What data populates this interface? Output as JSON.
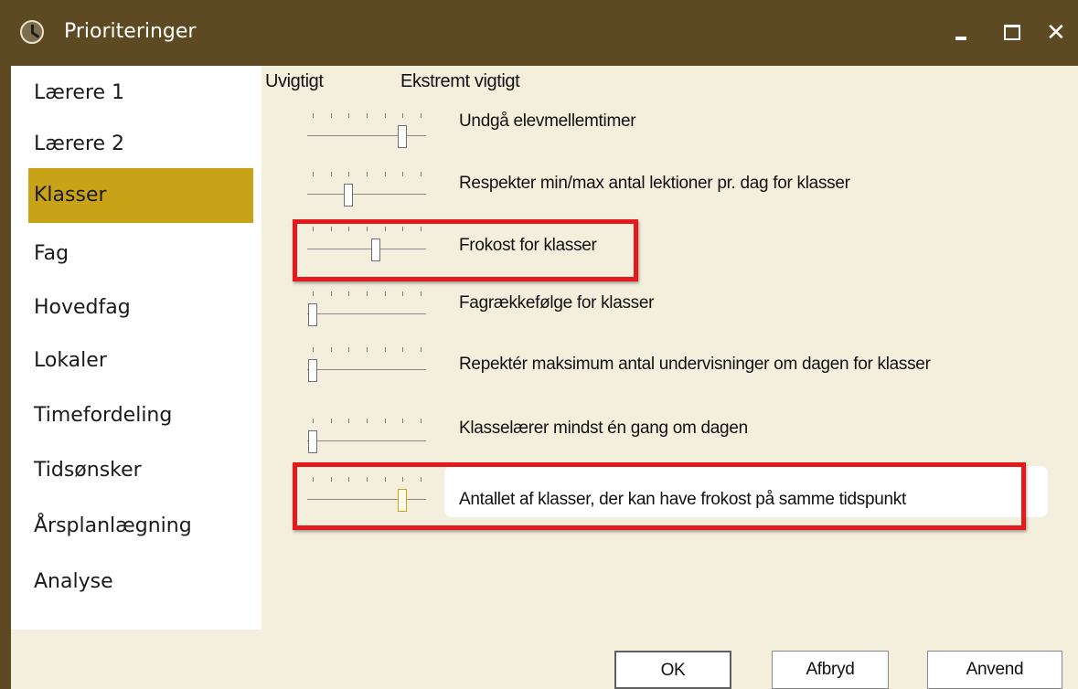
{
  "window": {
    "title": "Prioriteringer"
  },
  "window_controls": {
    "minimize": "minimize",
    "maximize": "maximize",
    "close": "✕"
  },
  "sidebar": {
    "items": [
      {
        "label": "Lærere 1",
        "active": false
      },
      {
        "label": "Lærere 2",
        "active": false
      },
      {
        "label": "Klasser",
        "active": true
      },
      {
        "label": "Fag",
        "active": false
      },
      {
        "label": "Hovedfag",
        "active": false
      },
      {
        "label": "Lokaler",
        "active": false
      },
      {
        "label": "Timefordeling",
        "active": false
      },
      {
        "label": "Tidsønsker",
        "active": false
      },
      {
        "label": "Årsplanlægning",
        "active": false
      },
      {
        "label": "Analyse",
        "active": false
      }
    ]
  },
  "scale": {
    "low_label": "Uvigtigt",
    "high_label": "Ekstremt vigtigt",
    "ticks": 7
  },
  "priorities": [
    {
      "label": "Undgå elevmellemtimer",
      "level": 5,
      "highlighted": false
    },
    {
      "label": "Respekter min/max antal lektioner pr. dag for klasser",
      "level": 2,
      "highlighted": false
    },
    {
      "label": "Frokost for klasser",
      "level": 3.5,
      "highlighted": true
    },
    {
      "label": "Fagrækkefølge for klasser",
      "level": 0,
      "highlighted": false
    },
    {
      "label": "Repektér maksimum antal undervisninger om dagen for klasser",
      "level": 0,
      "highlighted": false
    },
    {
      "label": "Klasselærer mindst én gang om dagen",
      "level": 0,
      "highlighted": false
    },
    {
      "label": "Antallet af klasser, der kan have frokost på samme tidspunkt",
      "level": 5,
      "highlighted": true
    }
  ],
  "buttons": {
    "ok": "OK",
    "cancel": "Afbryd",
    "apply": "Anvend"
  },
  "colors": {
    "titlebar": "#5d4a22",
    "active_item": "#c8a317",
    "highlight_box": "#e3191c",
    "panel": "#f3efdc"
  }
}
